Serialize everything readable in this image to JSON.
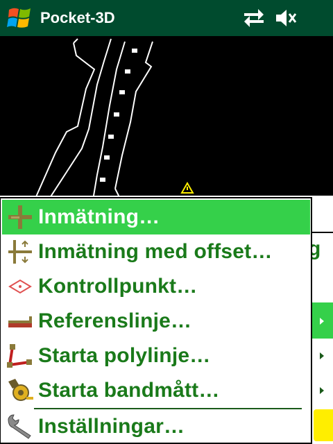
{
  "titlebar": {
    "app_title": "Pocket-3D",
    "icons": [
      "windows-start-logo",
      "connectivity-arrows-icon",
      "speaker-muted-icon"
    ]
  },
  "map": {
    "marker": "warning-triangle-marker"
  },
  "background_panel": {
    "partial_text": "g"
  },
  "menu": {
    "items": [
      {
        "label": "Inmätning…",
        "icon": "survey-cross-icon",
        "selected": true
      },
      {
        "label": "Inmätning med offset…",
        "icon": "offset-arrows-icon",
        "selected": false
      },
      {
        "label": "Kontrollpunkt…",
        "icon": "control-point-diamond-icon",
        "selected": false
      },
      {
        "label": "Referenslinje…",
        "icon": "reference-line-icon",
        "selected": false
      },
      {
        "label": "Starta polylinje…",
        "icon": "polyline-icon",
        "selected": false
      },
      {
        "label": "Starta bandmått…",
        "icon": "tape-measure-icon",
        "selected": false
      },
      {
        "label": "Inställningar…",
        "icon": "wrench-settings-icon",
        "selected": false
      }
    ]
  },
  "colors": {
    "titlebar": "#004b2e",
    "highlight": "#35d04a",
    "menu_text": "#1a7a1a",
    "accent_yellow": "#ffee00"
  }
}
